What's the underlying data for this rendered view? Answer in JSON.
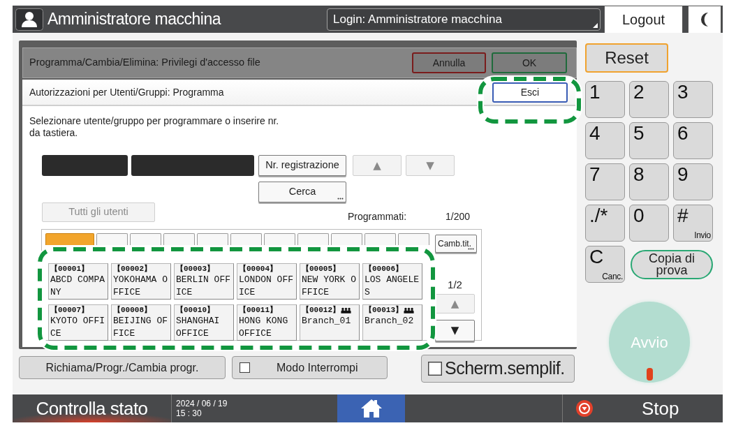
{
  "top_bar": {
    "title": "Amministratore macchina",
    "login": "Login: Amministratore macchina",
    "logout_button": "Logout"
  },
  "dialog": {
    "title": "Programma/Cambia/Elimina: Privilegi d'accesso file",
    "buttons": [
      {
        "kind": "cancel",
        "label": "Annulla"
      },
      {
        "kind": "ok",
        "label": "OK"
      }
    ],
    "panel": {
      "title": "Autorizzazioni per Utenti/Gruppi: Programma",
      "exit_button": "Esci",
      "instruction": "Selezionare utente/gruppo per programmare o inserire nr.\nda tastiera.",
      "registration_number_button": "Nr. registrazione",
      "scroll_buttons": [
        {
          "symbol": "▲",
          "disabled": true
        },
        {
          "symbol": "▼",
          "disabled": true
        }
      ],
      "search_button": "Cerca",
      "all_users_button": {
        "label": "Tutti gli utenti",
        "disabled": true
      },
      "programmed_label": "Programmati:",
      "programmed_count": "1/200",
      "index_tabs": [
        {
          "selected": true
        },
        {
          "selected": false
        },
        {
          "selected": false
        },
        {
          "selected": false
        },
        {
          "selected": false
        },
        {
          "selected": false
        },
        {
          "selected": false
        },
        {
          "selected": false
        },
        {
          "selected": false
        },
        {
          "selected": false
        },
        {
          "selected": false
        }
      ],
      "change_title_button": "Camb.tit.",
      "entries": [
        {
          "kind": "user",
          "number": "【00001】",
          "name": "ABCD COMPA\nNY"
        },
        {
          "kind": "user",
          "number": "【00002】",
          "name": "YOKOHAMA O\nFFICE"
        },
        {
          "kind": "user",
          "number": "【00003】",
          "name": "BERLIN OFF\nICE"
        },
        {
          "kind": "user",
          "number": "【00004】",
          "name": "LONDON OFF\nICE"
        },
        {
          "kind": "user",
          "number": "【00005】",
          "name": "NEW YORK O\nFFICE"
        },
        {
          "kind": "user",
          "number": "【00006】",
          "name": "LOS ANGELE\nS"
        },
        {
          "kind": "user",
          "number": "【00007】",
          "name": "KYOTO OFFI\nCE"
        },
        {
          "kind": "user",
          "number": "【00008】",
          "name": "BEIJING OF\nFICE"
        },
        {
          "kind": "user",
          "number": "【00010】",
          "name": "SHANGHAI\nOFFICE"
        },
        {
          "kind": "user",
          "number": "【00011】",
          "name": "HONG KONG\nOFFICE"
        },
        {
          "kind": "group",
          "number": "【00012】",
          "name": "Branch_01"
        },
        {
          "kind": "group",
          "number": "【00013】",
          "name": "Branch_02"
        }
      ],
      "page": "1/2",
      "page_buttons": [
        {
          "symbol": "▲",
          "disabled": true
        },
        {
          "symbol": "▼",
          "disabled": false
        }
      ]
    }
  },
  "bottom_buttons": [
    {
      "kind": "plain",
      "label": "Richiama/Progr./Cambia progr."
    },
    {
      "kind": "toggle",
      "label": "Modo Interrompi",
      "checked": false
    }
  ],
  "simple_screen_button": {
    "label": "Scherm.semplif.",
    "checked": false
  },
  "keypad": {
    "reset_button": "Reset",
    "keys": [
      {
        "label": "1"
      },
      {
        "label": "2"
      },
      {
        "label": "3"
      },
      {
        "label": "4"
      },
      {
        "label": "5"
      },
      {
        "label": "6"
      },
      {
        "label": "7"
      },
      {
        "label": "8"
      },
      {
        "label": "9"
      },
      {
        "label": "./*"
      },
      {
        "label": "0"
      },
      {
        "label": "#",
        "sub": "Invio"
      },
      {
        "label": "C",
        "sub": "Canc."
      }
    ],
    "proof_copy_button": "Copia di prova",
    "start_button": "Avvio"
  },
  "status_bar": {
    "status_button": "Controlla stato",
    "date": "2024 / 06 / 19",
    "time": "15 : 30",
    "stop_button": "Stop"
  }
}
